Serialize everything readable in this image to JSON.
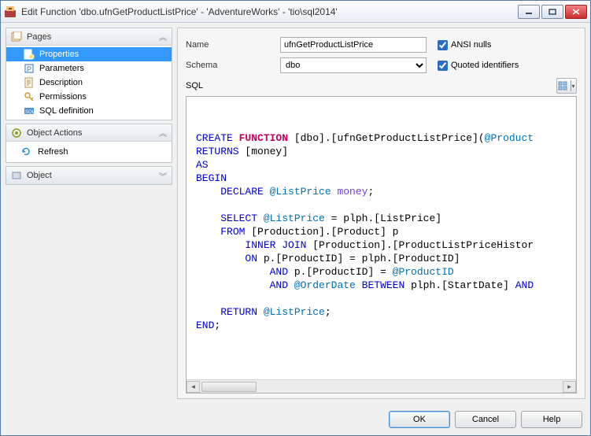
{
  "titlebar": {
    "title": "Edit Function 'dbo.ufnGetProductListPrice' - 'AdventureWorks' - 'tio\\sql2014'"
  },
  "sidebar": {
    "pages": {
      "label": "Pages",
      "items": [
        {
          "label": "Properties"
        },
        {
          "label": "Parameters"
        },
        {
          "label": "Description"
        },
        {
          "label": "Permissions"
        },
        {
          "label": "SQL definition"
        }
      ]
    },
    "actions": {
      "label": "Object Actions",
      "items": [
        {
          "label": "Refresh"
        }
      ]
    },
    "object": {
      "label": "Object"
    }
  },
  "form": {
    "name_label": "Name",
    "name_value": "ufnGetProductListPrice",
    "schema_label": "Schema",
    "schema_value": "dbo",
    "ansi_label": "ANSI nulls",
    "quoted_label": "Quoted identifiers",
    "sql_label": "SQL"
  },
  "sql": {
    "l1a": "CREATE",
    "l1b": " FUNCTION",
    "l1c": " [dbo].[ufnGetProductListPrice](",
    "l1d": "@Product",
    "l2a": "RETURNS",
    "l2b": " [money]",
    "l3a": "AS",
    "l4a": "BEGIN",
    "l5a": "    ",
    "l5b": "DECLARE",
    "l5c": " @ListPrice",
    "l5d": " money",
    "l5e": ";",
    "l6a": "    ",
    "l6b": "SELECT",
    "l6c": " @ListPrice",
    "l6d": " = plph.[ListPrice]",
    "l7a": "    ",
    "l7b": "FROM",
    "l7c": " [Production].[Product] p ",
    "l8a": "        ",
    "l8b": "INNER",
    "l8c": " JOIN",
    "l8d": " [Production].[ProductListPriceHistor",
    "l9a": "        ",
    "l9b": "ON",
    "l9c": " p.[ProductID] = plph.[ProductID] ",
    "l10a": "            ",
    "l10b": "AND",
    "l10c": " p.[ProductID] = ",
    "l10d": "@ProductID",
    "l11a": "            ",
    "l11b": "AND",
    "l11c": " @OrderDate",
    "l11d": " BETWEEN",
    "l11e": " plph.[StartDate] ",
    "l11f": "AND",
    "l12a": "    ",
    "l12b": "RETURN",
    "l12c": " @ListPrice",
    "l12d": ";",
    "l13a": "END",
    "l13b": ";"
  },
  "buttons": {
    "ok": "OK",
    "cancel": "Cancel",
    "help": "Help"
  }
}
